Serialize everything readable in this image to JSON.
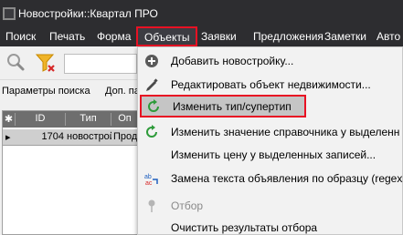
{
  "window": {
    "title": "Новостройки::Квартал ПРО"
  },
  "menubar": {
    "items": [
      {
        "label": "Поиск"
      },
      {
        "label": "Печать"
      },
      {
        "label": "Форма"
      },
      {
        "label": "Объекты",
        "active": true
      },
      {
        "label": "Заявки"
      },
      {
        "label": "Предложения"
      },
      {
        "label": "Заметки"
      },
      {
        "label": "Авто"
      }
    ]
  },
  "toolbar": {
    "search_icon": "search-icon",
    "filter_icon": "filter-clear-icon"
  },
  "sub_toolbar": {
    "tabs": [
      {
        "label": "Параметры поиска"
      },
      {
        "label": "Доп. па"
      }
    ]
  },
  "grid": {
    "columns": [
      "ID",
      "Тип",
      "Оп"
    ],
    "rows": [
      {
        "id": "1704",
        "type": "новострой",
        "op": "Прод"
      }
    ]
  },
  "objects_menu": {
    "items": [
      {
        "label": "Добавить новостройку...",
        "icon": "plus-circle-icon",
        "enabled": true
      },
      {
        "label": "Редактировать объект недвижимости...",
        "icon": "pencil-icon",
        "enabled": true
      },
      {
        "label": "Изменить тип/супертип",
        "icon": "refresh-icon",
        "enabled": true,
        "highlighted": true
      },
      {
        "label": "Изменить значение справочника у выделенн",
        "icon": "refresh-icon",
        "enabled": true
      },
      {
        "label": "Изменить цену у выделенных записей...",
        "icon": "",
        "enabled": true
      },
      {
        "label": "Замена текста объявления по образцу (regexp",
        "icon": "replace-icon",
        "enabled": true
      },
      {
        "label": "Отбор",
        "icon": "pin-icon",
        "enabled": false
      },
      {
        "label": "Очистить результаты отбора",
        "icon": "",
        "enabled": true
      }
    ]
  },
  "colors": {
    "titlebar_bg": "#2d2d30",
    "highlight_border": "#e81123",
    "menu_bg": "#f2f2f2",
    "refresh_green": "#2e9b3a"
  }
}
